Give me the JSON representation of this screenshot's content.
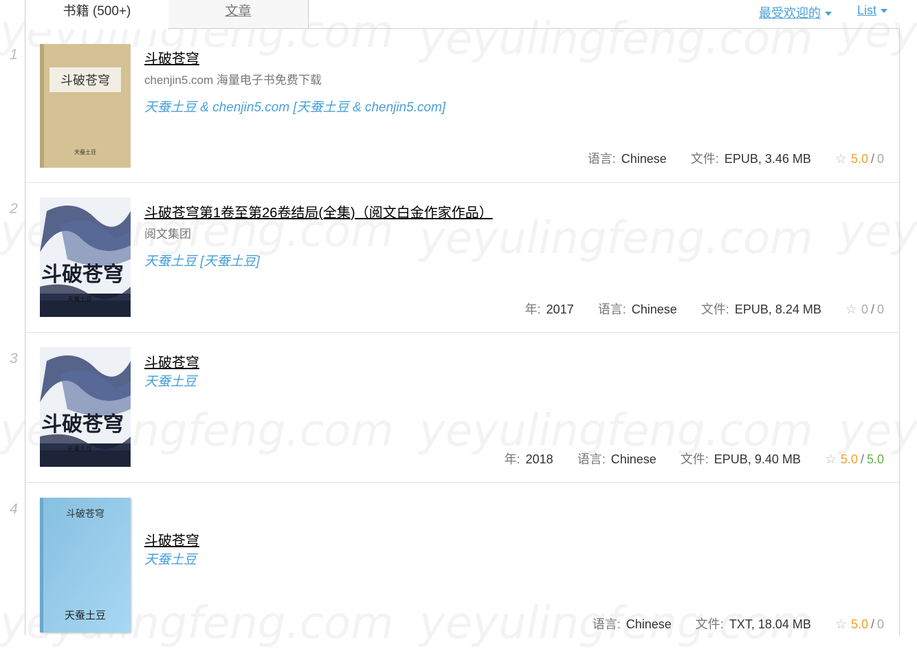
{
  "tabs": {
    "books": "书籍 (500+)",
    "articles": "文章"
  },
  "sort": {
    "popular": "最受欢迎的",
    "view": "List"
  },
  "watermark": "yeyulingfeng.com",
  "labels": {
    "year": "年:",
    "language": "语言:",
    "file": "文件:"
  },
  "books": [
    {
      "num": "1",
      "title": "斗破苍穹",
      "publisher": "chenjin5.com 海量电子书免费下载",
      "authors": "天蚕土豆 & chenjin5.com [天蚕土豆 & chenjin5.com]",
      "year": "",
      "language": "Chinese",
      "file": "EPUB, 3.46 MB",
      "rating": "5.0",
      "quality": "0",
      "cover": {
        "title": "斗破苍穹",
        "author": "天蚕土豆"
      }
    },
    {
      "num": "2",
      "title": "斗破苍穹第1卷至第26卷结局(全集)（阅文白金作家作品）",
      "publisher": "阅文集团",
      "authors": "天蚕土豆 [天蚕土豆]",
      "year": "2017",
      "language": "Chinese",
      "file": "EPUB, 8.24 MB",
      "rating": "0",
      "quality": "0",
      "cover": {
        "title": "斗破苍穹",
        "author": "天蚕土豆"
      }
    },
    {
      "num": "3",
      "title": "斗破苍穹",
      "publisher": "",
      "authors": "天蚕土豆",
      "year": "2018",
      "language": "Chinese",
      "file": "EPUB, 9.40 MB",
      "rating": "5.0",
      "quality": "5.0",
      "cover": {
        "title": "斗破苍穹",
        "author": "天蚕土豆"
      }
    },
    {
      "num": "4",
      "title": "斗破苍穹",
      "publisher": "",
      "authors": "天蚕土豆",
      "year": "",
      "language": "Chinese",
      "file": "TXT, 18.04 MB",
      "rating": "5.0",
      "quality": "0",
      "cover": {
        "title": "斗破苍穹",
        "author": "天蚕土豆"
      }
    }
  ],
  "colors": {
    "link": "#49a0d8",
    "rating": "#f0a030",
    "quality_good": "#6ab04c",
    "muted": "#aaaaaa"
  },
  "icons": [
    "star-icon",
    "caret-down-icon"
  ]
}
